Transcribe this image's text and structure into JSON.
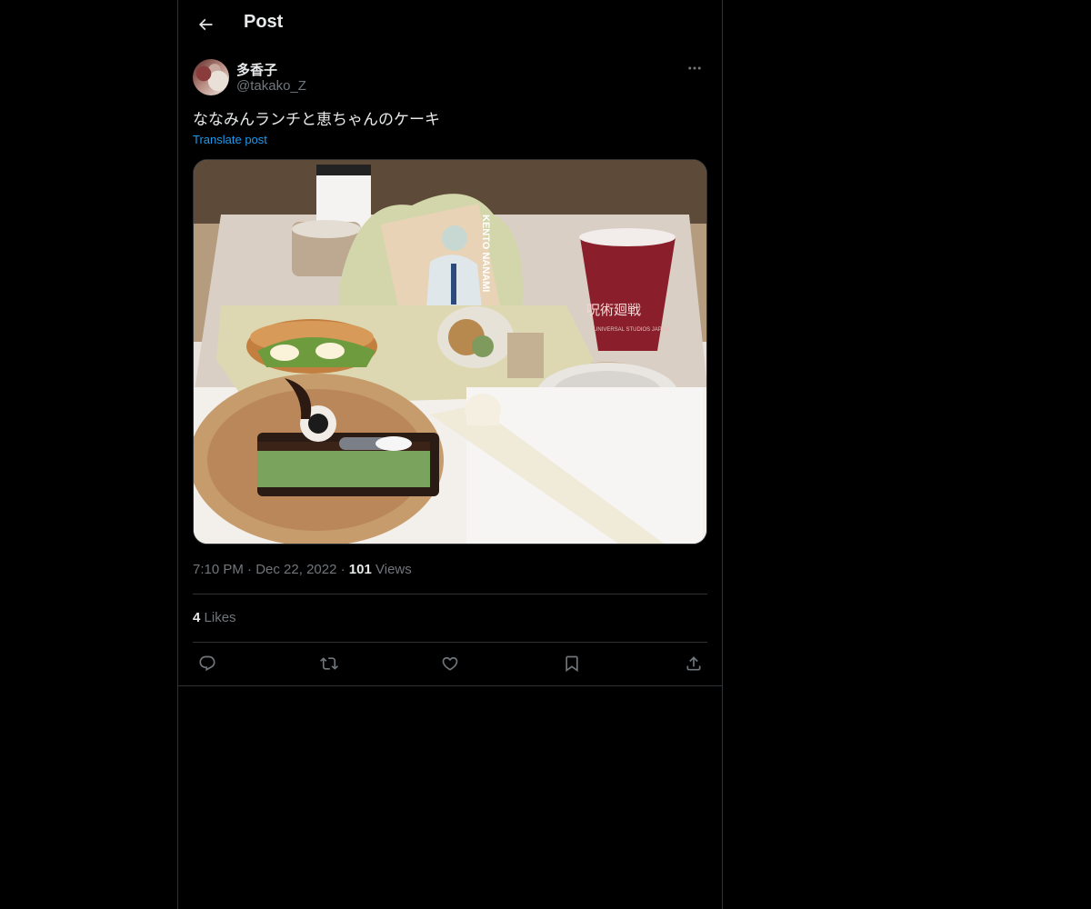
{
  "header": {
    "title": "Post"
  },
  "author": {
    "display_name": "多香子",
    "handle": "@takako_Z"
  },
  "post": {
    "text": "ななみんランチと恵ちゃんのケーキ",
    "translate_label": "Translate post",
    "media": {
      "cup_text": "呪術廻戦",
      "cup_subtext": "UNIVERSAL STUDIOS JAPAN",
      "card_text": "KENTO NANAMI"
    }
  },
  "meta": {
    "time": "7:10 PM",
    "date": "Dec 22, 2022",
    "views_count": "101",
    "views_label": "Views"
  },
  "engagement": {
    "likes_count": "4",
    "likes_label": "Likes"
  },
  "icons": [
    "back-arrow-icon",
    "more-icon",
    "reply-icon",
    "repost-icon",
    "like-icon",
    "bookmark-icon",
    "share-icon"
  ],
  "colors": {
    "background": "#000000",
    "text": "#e7e9ea",
    "muted": "#71767b",
    "link": "#1d9bf0",
    "border": "#2f3336"
  }
}
